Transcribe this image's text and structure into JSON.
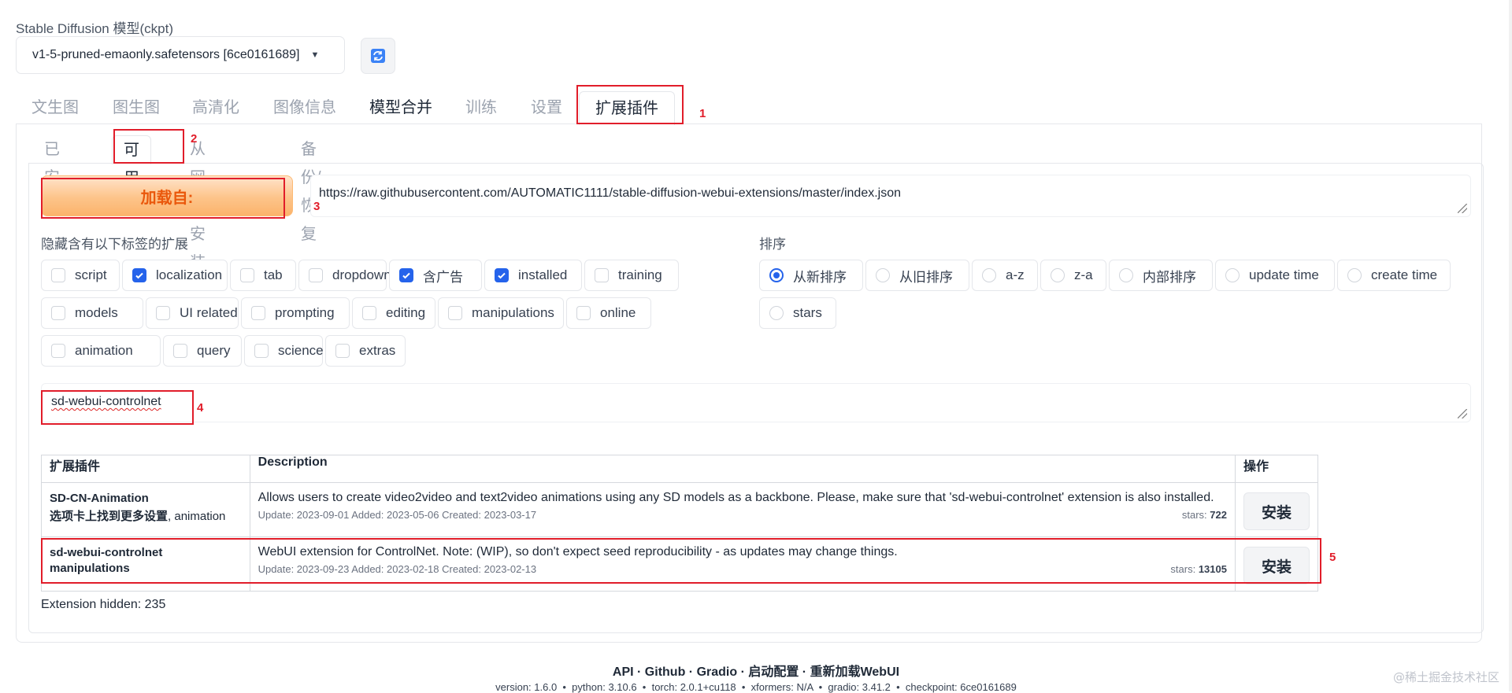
{
  "model": {
    "label": "Stable Diffusion 模型(ckpt)",
    "value": "v1-5-pruned-emaonly.safetensors [6ce0161689]"
  },
  "main_tabs": [
    "文生图",
    "图生图",
    "高清化",
    "图像信息",
    "模型合并",
    "训练",
    "设置",
    "扩展插件"
  ],
  "sub_tabs": [
    "已安装",
    "可用",
    "从网址安装",
    "备份/恢复"
  ],
  "load_button": "加载自:",
  "index_url": "https://raw.githubusercontent.com/AUTOMATIC1111/stable-diffusion-webui-extensions/master/index.json",
  "hide_tags": {
    "label": "隐藏含有以下标签的扩展",
    "items": [
      {
        "label": "script",
        "checked": false
      },
      {
        "label": "localization",
        "checked": true
      },
      {
        "label": "tab",
        "checked": false
      },
      {
        "label": "dropdown",
        "checked": false
      },
      {
        "label": "含广告",
        "checked": true
      },
      {
        "label": "installed",
        "checked": true
      },
      {
        "label": "training",
        "checked": false
      },
      {
        "label": "models",
        "checked": false
      },
      {
        "label": "UI related",
        "checked": false
      },
      {
        "label": "prompting",
        "checked": false
      },
      {
        "label": "editing",
        "checked": false
      },
      {
        "label": "manipulations",
        "checked": false
      },
      {
        "label": "online",
        "checked": false
      },
      {
        "label": "animation",
        "checked": false
      },
      {
        "label": "query",
        "checked": false
      },
      {
        "label": "science",
        "checked": false
      },
      {
        "label": "extras",
        "checked": false
      }
    ]
  },
  "sort": {
    "label": "排序",
    "items": [
      {
        "label": "从新排序",
        "selected": true
      },
      {
        "label": "从旧排序",
        "selected": false
      },
      {
        "label": "a-z",
        "selected": false
      },
      {
        "label": "z-a",
        "selected": false
      },
      {
        "label": "内部排序",
        "selected": false
      },
      {
        "label": "update time",
        "selected": false
      },
      {
        "label": "create time",
        "selected": false
      },
      {
        "label": "stars",
        "selected": false
      }
    ]
  },
  "search_value": "sd-webui-controlnet",
  "table": {
    "headers": [
      "扩展插件",
      "Description",
      "操作"
    ],
    "rows": [
      {
        "name": "SD-CN-Animation",
        "tags_bold": "选项卡上找到更多设置",
        "tags_rest": ", animation",
        "description": "Allows users to create video2video and text2video animations using any SD models as a backbone. Please, make sure that 'sd-webui-controlnet' extension is also installed.",
        "dates": "Update: 2023-09-01 Added: 2023-05-06 Created: 2023-03-17",
        "stars_label": "stars: ",
        "stars": "722",
        "action": "安装"
      },
      {
        "name": "sd-webui-controlnet",
        "tags_bold": "manipulations",
        "tags_rest": "",
        "description": "WebUI extension for ControlNet. Note: (WIP), so don't expect seed reproducibility - as updates may change things.",
        "dates": "Update: 2023-09-23 Added: 2023-02-18 Created: 2023-02-13",
        "stars_label": "stars: ",
        "stars": "13105",
        "action": "安装"
      }
    ]
  },
  "hidden_count": "Extension hidden: 235",
  "annotations": [
    "1",
    "2",
    "3",
    "4",
    "5"
  ],
  "footer": {
    "links": [
      "API",
      "Github",
      "Gradio",
      "启动配置",
      "重新加载WebUI"
    ],
    "separator": " · ",
    "info": "version: 1.6.0  •  python: 3.10.6  •  torch: 2.0.1+cu118  •  xformers: N/A  •  gradio: 3.41.2  •  checkpoint: 6ce0161689"
  },
  "watermark": "@稀土掘金技术社区",
  "colors": {
    "accent": "#2563eb",
    "annotation": "#e11d2a",
    "load_button": "#ea580c"
  }
}
